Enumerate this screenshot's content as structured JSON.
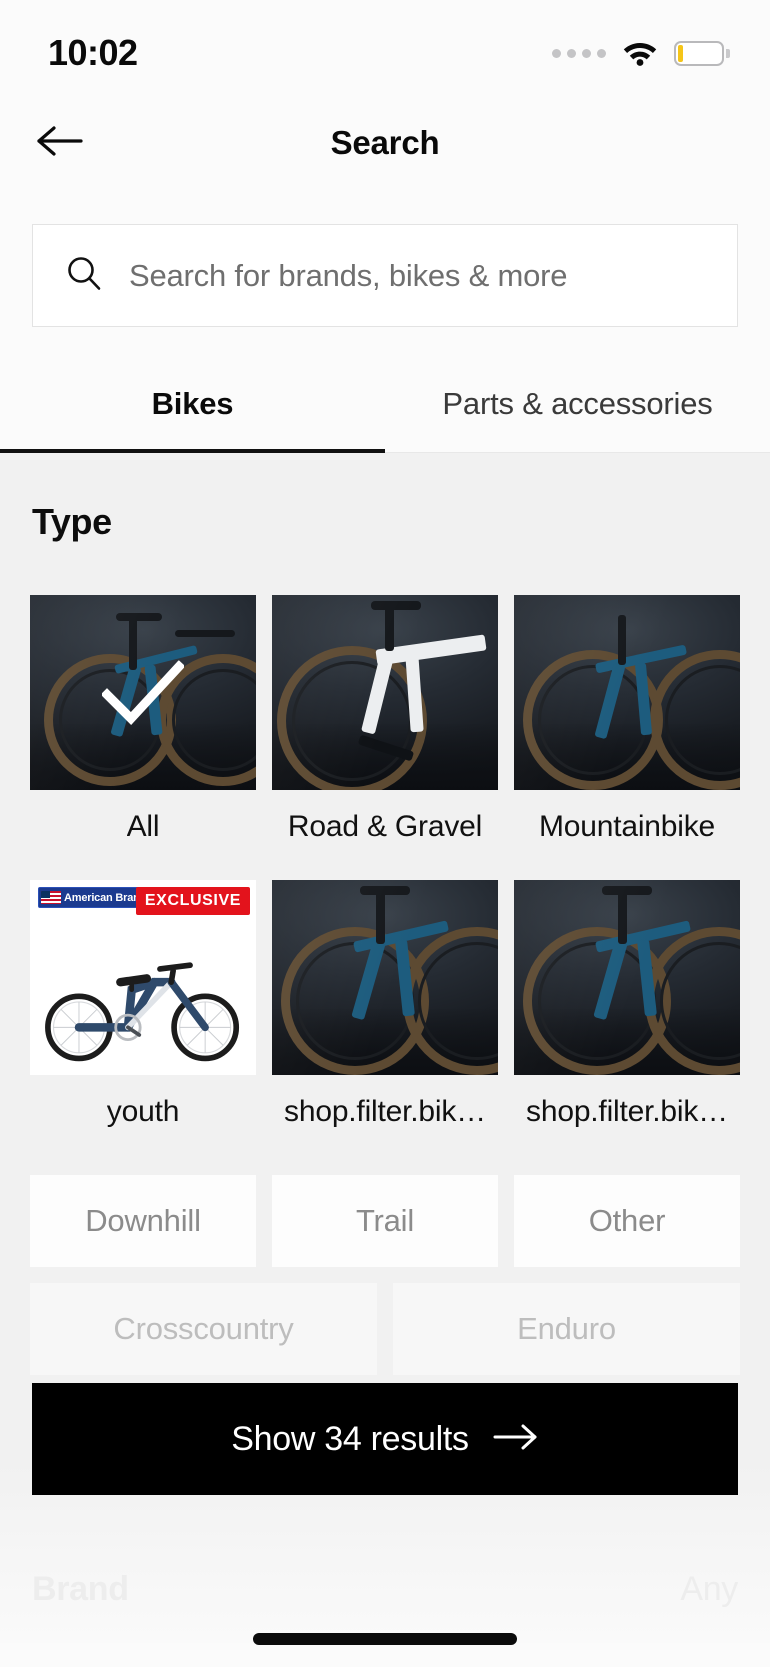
{
  "status_bar": {
    "time": "10:02",
    "signal_icon": "signal-dots-icon",
    "wifi_icon": "wifi-icon",
    "battery_icon": "battery-low-icon",
    "battery_level_pct": 10,
    "battery_accent": "#f5c518"
  },
  "nav": {
    "back_icon": "arrow-left-icon",
    "title": "Search"
  },
  "search": {
    "icon": "search-icon",
    "placeholder": "Search for brands, bikes & more",
    "value": ""
  },
  "tabs": [
    {
      "label": "Bikes",
      "active": true
    },
    {
      "label": "Parts & accessories",
      "active": false
    }
  ],
  "filter_panel": {
    "section_title": "Type",
    "type_options": [
      {
        "label": "All",
        "selected": true,
        "thumb": "dark-studio-gravel-bike",
        "check_icon": "check-icon"
      },
      {
        "label": "Road & Gravel",
        "selected": false,
        "thumb": "dark-studio-white-road-bike"
      },
      {
        "label": "Mountainbike",
        "selected": false,
        "thumb": "dark-studio-mountain-bike"
      },
      {
        "label": "youth",
        "selected": false,
        "thumb": "white-bg-youth-bike",
        "badge_brand": "American Brand",
        "badge_flag_icon": "us-flag-icon",
        "badge_exclusive": "EXCLUSIVE"
      },
      {
        "label": "shop.filter.bik…",
        "selected": false,
        "thumb": "dark-studio-blue-bike"
      },
      {
        "label": "shop.filter.bik…",
        "selected": false,
        "thumb": "dark-studio-blue-bike-2"
      }
    ],
    "chips_row1": [
      {
        "label": "Downhill"
      },
      {
        "label": "Trail"
      },
      {
        "label": "Other"
      }
    ],
    "chips_row2": [
      {
        "label": "Crosscountry"
      },
      {
        "label": "Enduro"
      }
    ]
  },
  "cta": {
    "label": "Show 34 results",
    "arrow_icon": "arrow-right-icon",
    "result_count": 34,
    "background": "#000000"
  },
  "obscured_section": {
    "title": "Brand",
    "value": "Any"
  },
  "home_indicator": "home-indicator"
}
